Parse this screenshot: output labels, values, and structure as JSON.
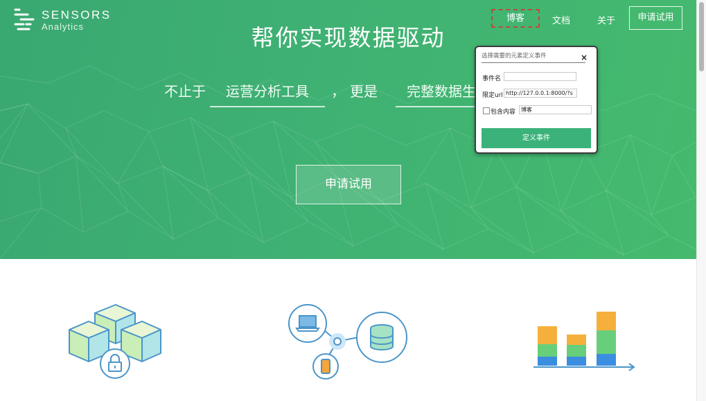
{
  "brand": {
    "name_line1": "SENSORS",
    "name_line2": "Analytics",
    "logo_icon": "sensors-logo-icon"
  },
  "nav": {
    "blog": "博客",
    "docs": "文档",
    "about": "关于",
    "trial": "申请试用"
  },
  "hero": {
    "title": "帮你实现数据驱动",
    "slogan_prefix": "不止于",
    "slogan_word1": "运营分析工具",
    "slogan_comma": "，",
    "slogan_middle": "更是",
    "slogan_word2": "完整数据生",
    "cta": "申请试用"
  },
  "popup": {
    "header": "选择需要的元素定义事件",
    "close": "×",
    "event_name_label": "事件名",
    "event_name_value": "",
    "url_label": "限定url",
    "url_value": "http://127.0.0.1:8000/?s",
    "contain_label": "包含内容",
    "contain_value": "博客",
    "contain_checked": false,
    "submit": "定义事件"
  },
  "features": [
    {
      "icon": "data-cubes-lock-icon"
    },
    {
      "icon": "devices-database-network-icon"
    },
    {
      "icon": "stacked-bar-chart-icon"
    }
  ],
  "colors": {
    "brand_green": "#3fb173",
    "button_green": "#3bb27a",
    "highlight_dashed": "#c4463d"
  }
}
